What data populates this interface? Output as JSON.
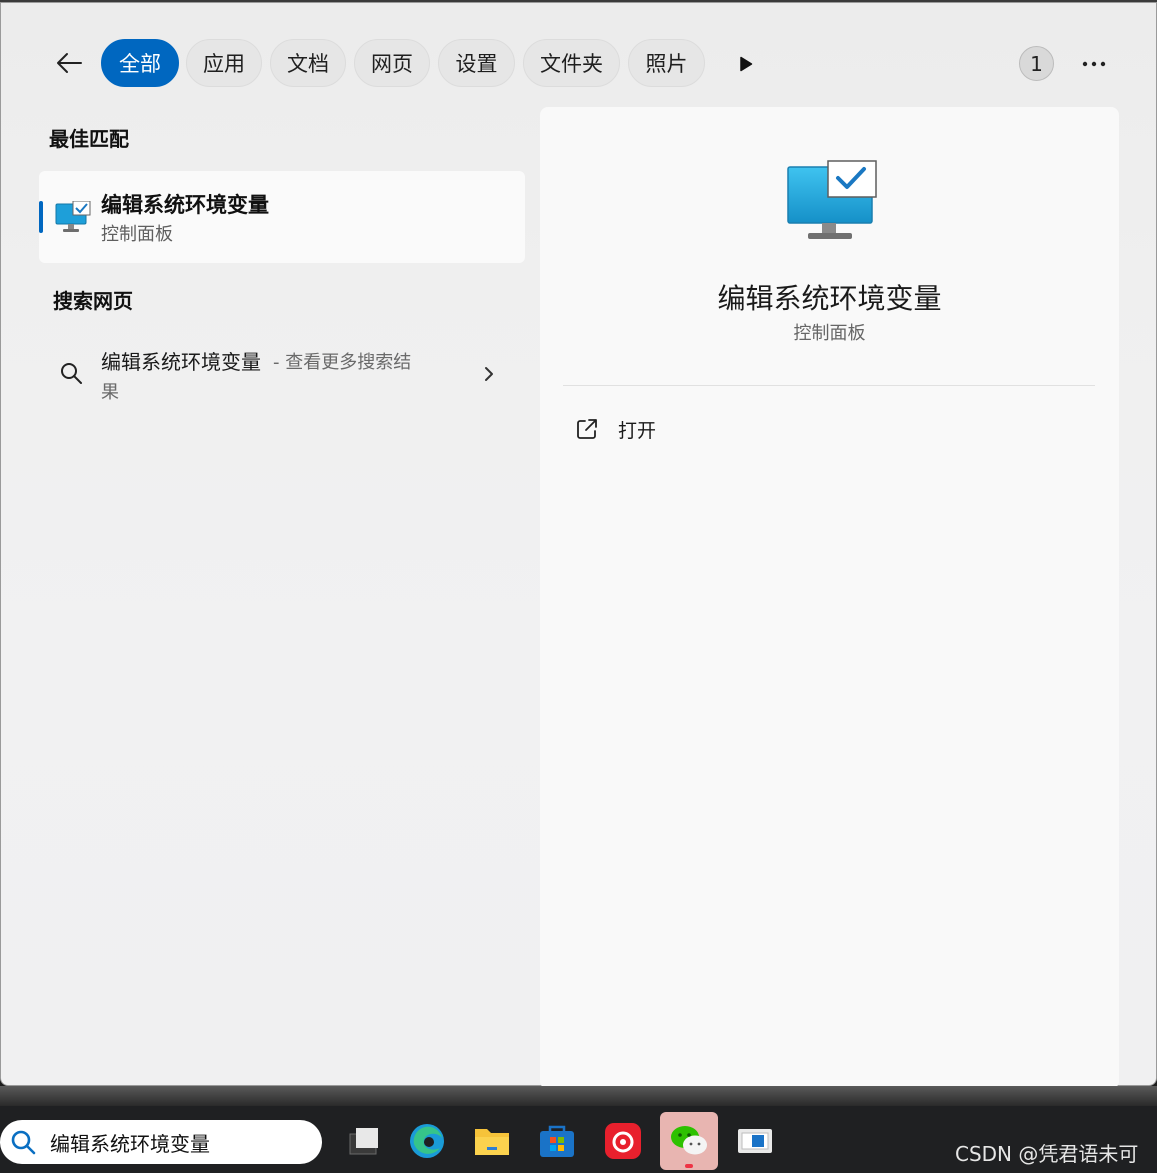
{
  "filters": {
    "tabs": [
      {
        "label": "全部",
        "active": true
      },
      {
        "label": "应用",
        "active": false
      },
      {
        "label": "文档",
        "active": false
      },
      {
        "label": "网页",
        "active": false
      },
      {
        "label": "设置",
        "active": false
      },
      {
        "label": "文件夹",
        "active": false
      },
      {
        "label": "照片",
        "active": false
      }
    ],
    "count": "1"
  },
  "best_match": {
    "section_title": "最佳匹配",
    "title": "编辑系统环境变量",
    "subtitle": "控制面板"
  },
  "web_search": {
    "section_title": "搜索网页",
    "query": "编辑系统环境变量",
    "hint": "- 查看更多搜索结",
    "hint_cont": "果"
  },
  "preview": {
    "title": "编辑系统环境变量",
    "subtitle": "控制面板",
    "actions": [
      {
        "label": "打开",
        "icon": "open-external-icon"
      }
    ]
  },
  "taskbar": {
    "search_value": "编辑系统环境变量",
    "apps": [
      "task-view-icon",
      "edge-icon",
      "file-explorer-icon",
      "microsoft-store-icon",
      "netease-music-icon",
      "wechat-icon",
      "window-app-icon"
    ],
    "watermark": "CSDN @凭君语未可"
  },
  "colors": {
    "accent": "#0067c0"
  }
}
